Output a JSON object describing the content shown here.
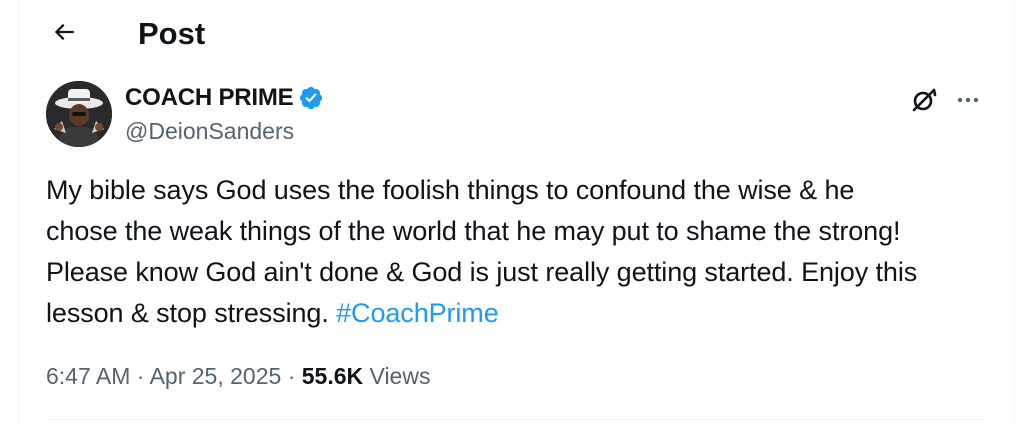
{
  "header": {
    "title": "Post",
    "back_icon": "arrow-left-icon"
  },
  "author": {
    "display_name": "COACH PRIME",
    "handle": "@DeionSanders",
    "verified": true,
    "verified_color": "#1d9bf0",
    "avatar_icon": "avatar-photo"
  },
  "actions": {
    "grok_icon": "grok-icon",
    "more_icon": "more-dots-icon"
  },
  "tweet": {
    "lines": [
      "My bible says God uses the foolish things to confound the wise & he",
      "chose the weak things of the world that he may put to shame the strong!",
      "Please know God ain't done & God is just really getting started. Enjoy this",
      "lesson & stop stressing. "
    ],
    "hashtag": "#CoachPrime",
    "hashtag_color": "#1d9bf0"
  },
  "meta": {
    "time": "6:47 AM",
    "separator": "·",
    "date": "Apr 25, 2025",
    "views_count": "55.6K",
    "views_label": "Views"
  }
}
